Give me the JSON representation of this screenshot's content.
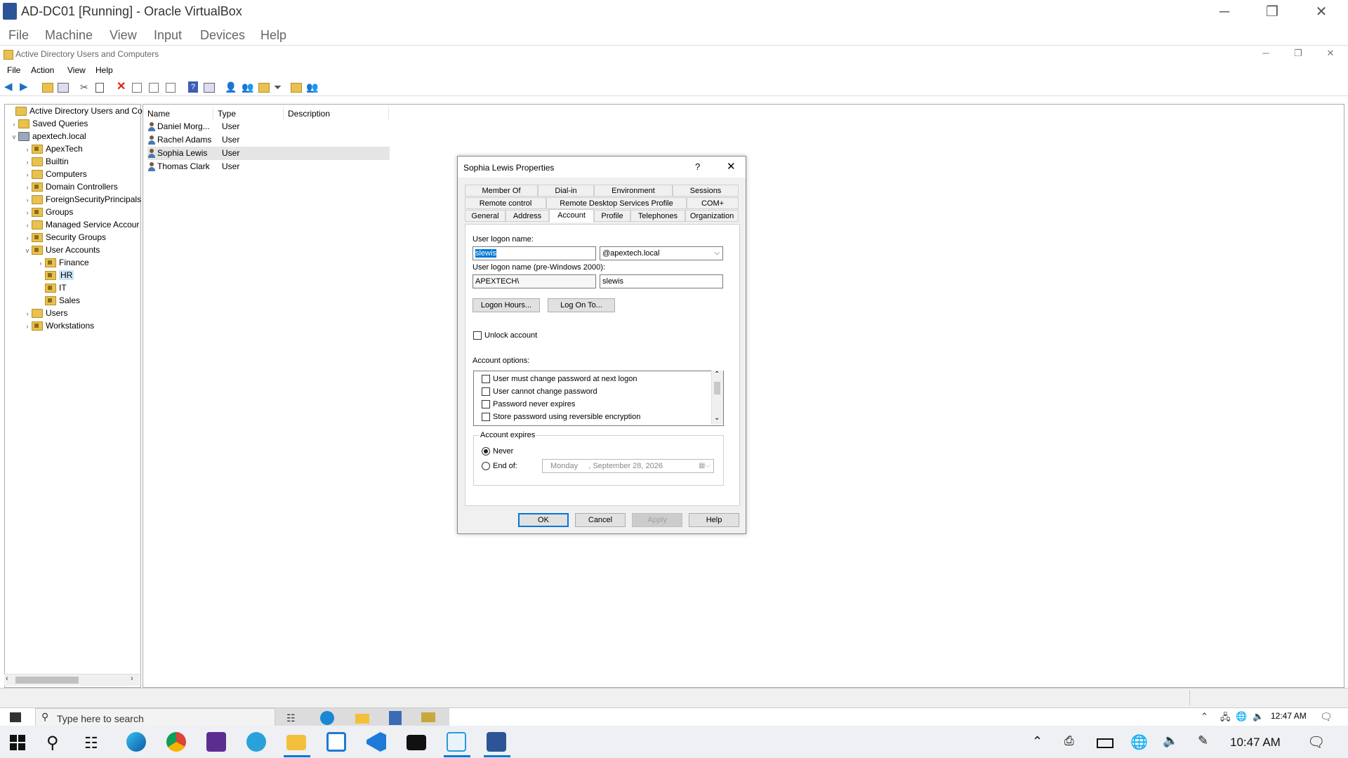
{
  "vbox": {
    "title": "AD-DC01 [Running] - Oracle VirtualBox",
    "menu": [
      "File",
      "Machine",
      "View",
      "Input",
      "Devices",
      "Help"
    ]
  },
  "aduc": {
    "title": "Active Directory Users and Computers",
    "menu": [
      "File",
      "Action",
      "View",
      "Help"
    ]
  },
  "tree": [
    {
      "label": "Active Directory Users and Com",
      "level": 0,
      "twisty": "",
      "icon": "folder"
    },
    {
      "label": "Saved Queries",
      "level": 1,
      "twisty": "›",
      "icon": "folder"
    },
    {
      "label": "apextech.local",
      "level": 1,
      "twisty": "v",
      "icon": "domain"
    },
    {
      "label": "ApexTech",
      "level": 2,
      "twisty": "›",
      "icon": "ou"
    },
    {
      "label": "Builtin",
      "level": 2,
      "twisty": "›",
      "icon": "folder"
    },
    {
      "label": "Computers",
      "level": 2,
      "twisty": "›",
      "icon": "folder"
    },
    {
      "label": "Domain Controllers",
      "level": 2,
      "twisty": "›",
      "icon": "ou"
    },
    {
      "label": "ForeignSecurityPrincipals",
      "level": 2,
      "twisty": "›",
      "icon": "folder"
    },
    {
      "label": "Groups",
      "level": 2,
      "twisty": "›",
      "icon": "ou"
    },
    {
      "label": "Managed Service Accour",
      "level": 2,
      "twisty": "›",
      "icon": "folder"
    },
    {
      "label": "Security Groups",
      "level": 2,
      "twisty": "›",
      "icon": "ou"
    },
    {
      "label": "User Accounts",
      "level": 2,
      "twisty": "v",
      "icon": "ou"
    },
    {
      "label": "Finance",
      "level": 3,
      "twisty": "›",
      "icon": "ou"
    },
    {
      "label": "HR",
      "level": 3,
      "twisty": "",
      "icon": "ou",
      "selected": true
    },
    {
      "label": "IT",
      "level": 3,
      "twisty": "",
      "icon": "ou"
    },
    {
      "label": "Sales",
      "level": 3,
      "twisty": "",
      "icon": "ou"
    },
    {
      "label": "Users",
      "level": 2,
      "twisty": "›",
      "icon": "folder"
    },
    {
      "label": "Workstations",
      "level": 2,
      "twisty": "›",
      "icon": "ou"
    }
  ],
  "list": {
    "columns": [
      "Name",
      "Type",
      "Description"
    ],
    "rows": [
      {
        "name": "Daniel Morg...",
        "type": "User"
      },
      {
        "name": "Rachel Adams",
        "type": "User"
      },
      {
        "name": "Sophia Lewis",
        "type": "User",
        "highlighted": true
      },
      {
        "name": "Thomas Clark",
        "type": "User"
      }
    ]
  },
  "dialog": {
    "title": "Sophia Lewis Properties",
    "help_glyph": "?",
    "close_glyph": "✕",
    "tabs_row1": [
      "Member Of",
      "Dial-in",
      "Environment",
      "Sessions"
    ],
    "tabs_row2": [
      "Remote control",
      "Remote Desktop Services Profile",
      "COM+"
    ],
    "tabs_row3": [
      "General",
      "Address",
      "Account",
      "Profile",
      "Telephones",
      "Organization"
    ],
    "active_tab": "Account",
    "logon_label": "User logon name:",
    "logon_value": "slewis",
    "upn_suffix": "@apextech.local",
    "pre2000_label": "User logon name (pre-Windows 2000):",
    "pre2000_domain": "APEXTECH\\",
    "pre2000_user": "slewis",
    "logon_hours_btn": "Logon Hours...",
    "log_on_to_btn": "Log On To...",
    "unlock_label": "Unlock account",
    "options_label": "Account options:",
    "options": [
      "User must change password at next logon",
      "User cannot change password",
      "Password never expires",
      "Store password using reversible encryption"
    ],
    "expires_label": "Account expires",
    "never_label": "Never",
    "endof_label": "End of:",
    "date_day": "Monday",
    "date_rest": ", September 28, 2026",
    "buttons": [
      "OK",
      "Cancel",
      "Apply",
      "Help"
    ]
  },
  "guest_taskbar": {
    "search_placeholder": "Type here to search",
    "time": "12:47 AM"
  },
  "host_taskbar": {
    "time": "10:47 AM"
  },
  "colors": {
    "accent": "#0078d7",
    "selection": "#cce4f7"
  }
}
